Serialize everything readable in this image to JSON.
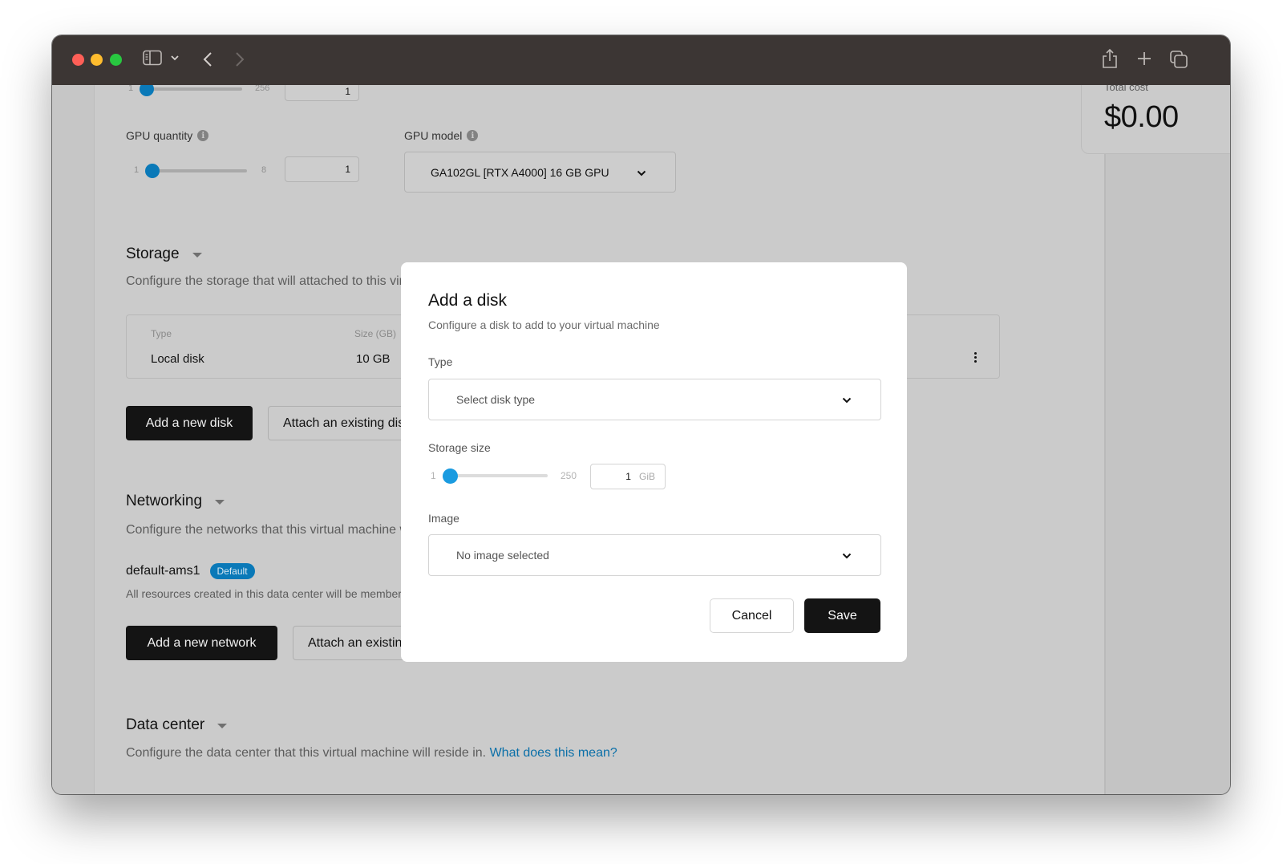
{
  "browser": {
    "toolbar_icons": [
      "sidebar-icon",
      "chevron-down-icon",
      "back-icon",
      "forward-icon",
      "share-icon",
      "new-tab-icon",
      "tab-overview-icon"
    ]
  },
  "summary": {
    "total_cost_label": "Total cost",
    "total_cost_value": "$0.00"
  },
  "top_slider": {
    "min": "1",
    "max": "256",
    "value": "1"
  },
  "gpu": {
    "quantity_label": "GPU quantity",
    "quantity_min": "1",
    "quantity_max": "8",
    "quantity_value": "1",
    "model_label": "GPU model",
    "model_value": "GA102GL [RTX A4000] 16 GB GPU"
  },
  "storage": {
    "title": "Storage",
    "description": "Configure the storage that will attached to this virtual machine.",
    "table": {
      "columns": [
        "Type",
        "Size (GB)"
      ],
      "rows": [
        {
          "type": "Local disk",
          "size": "10 GB"
        }
      ]
    },
    "add_button": "Add a new disk",
    "attach_button": "Attach an existing disk"
  },
  "networking": {
    "title": "Networking",
    "description": "Configure the networks that this virtual machine will be connected to.",
    "network_name": "default-ams1",
    "network_badge": "Default",
    "network_description": "All resources created in this data center will be members of this network.",
    "add_button": "Add a new network",
    "attach_button": "Attach an existing network"
  },
  "data_center": {
    "title": "Data center",
    "description": "Configure the data center that this virtual machine will reside in.",
    "link": "What does this mean?"
  },
  "modal": {
    "title": "Add a disk",
    "subtitle": "Configure a disk to add to your virtual machine",
    "type_label": "Type",
    "type_placeholder": "Select disk type",
    "storage_label": "Storage size",
    "storage_min": "1",
    "storage_max": "250",
    "storage_value": "1",
    "storage_unit": "GiB",
    "image_label": "Image",
    "image_placeholder": "No image selected",
    "cancel": "Cancel",
    "save": "Save"
  }
}
